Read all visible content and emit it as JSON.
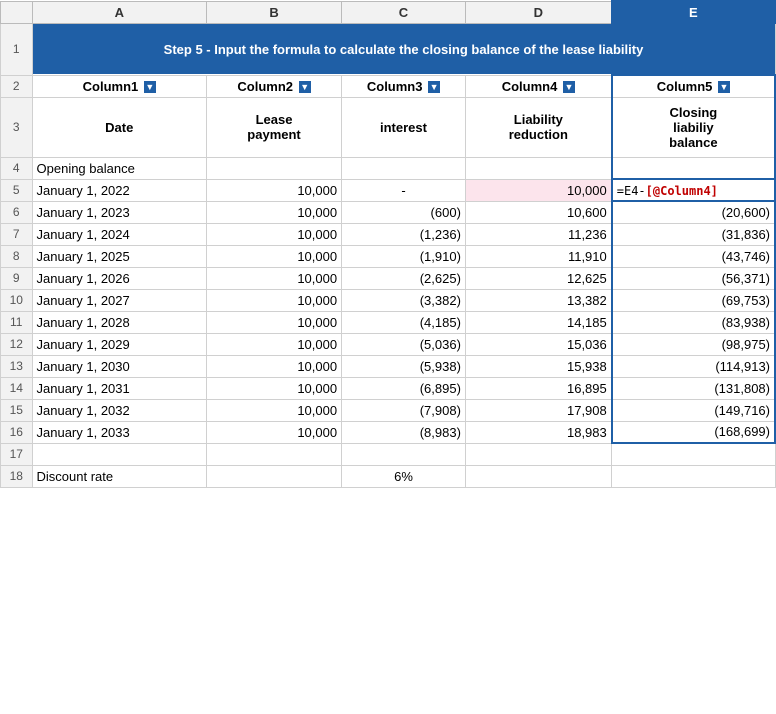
{
  "title": "Step 5 - Input the formula to calculate the closing balance of the lease liability",
  "columns": {
    "headers": [
      "",
      "A",
      "B",
      "C",
      "D",
      "E"
    ],
    "subHeaders": [
      "",
      "Date",
      "Lease payment",
      "interest",
      "Liability reduction",
      "Closing liabiliy balance"
    ]
  },
  "rows": [
    {
      "num": "1",
      "a": "",
      "b": "",
      "c": "",
      "d": "",
      "e": "",
      "merged": true
    },
    {
      "num": "2",
      "a": "Column1",
      "b": "Column2",
      "c": "Column3",
      "d": "Column4",
      "e": "Column5"
    },
    {
      "num": "3",
      "a": "Date",
      "b": "Lease payment",
      "c": "interest",
      "d": "Liability reduction",
      "e": "Closing liabiliy balance"
    },
    {
      "num": "4",
      "a": "Opening balance",
      "b": "",
      "c": "",
      "d": "",
      "e": ""
    },
    {
      "num": "5",
      "a": "January 1, 2022",
      "b": "10,000",
      "c": "-",
      "d": "10,000",
      "e": "=E4-[@Column4]"
    },
    {
      "num": "6",
      "a": "January 1, 2023",
      "b": "10,000",
      "c": "(600)",
      "d": "10,600",
      "e": "(20,600)"
    },
    {
      "num": "7",
      "a": "January 1, 2024",
      "b": "10,000",
      "c": "(1,236)",
      "d": "11,236",
      "e": "(31,836)"
    },
    {
      "num": "8",
      "a": "January 1, 2025",
      "b": "10,000",
      "c": "(1,910)",
      "d": "11,910",
      "e": "(43,746)"
    },
    {
      "num": "9",
      "a": "January 1, 2026",
      "b": "10,000",
      "c": "(2,625)",
      "d": "12,625",
      "e": "(56,371)"
    },
    {
      "num": "10",
      "a": "January 1, 2027",
      "b": "10,000",
      "c": "(3,382)",
      "d": "13,382",
      "e": "(69,753)"
    },
    {
      "num": "11",
      "a": "January 1, 2028",
      "b": "10,000",
      "c": "(4,185)",
      "d": "14,185",
      "e": "(83,938)"
    },
    {
      "num": "12",
      "a": "January 1, 2029",
      "b": "10,000",
      "c": "(5,036)",
      "d": "15,036",
      "e": "(98,975)"
    },
    {
      "num": "13",
      "a": "January 1, 2030",
      "b": "10,000",
      "c": "(5,938)",
      "d": "15,938",
      "e": "(114,913)"
    },
    {
      "num": "14",
      "a": "January 1, 2031",
      "b": "10,000",
      "c": "(6,895)",
      "d": "16,895",
      "e": "(131,808)"
    },
    {
      "num": "15",
      "a": "January 1, 2032",
      "b": "10,000",
      "c": "(7,908)",
      "d": "17,908",
      "e": "(149,716)"
    },
    {
      "num": "16",
      "a": "January 1, 2033",
      "b": "10,000",
      "c": "(8,983)",
      "d": "18,983",
      "e": "(168,699)"
    },
    {
      "num": "17",
      "a": "",
      "b": "",
      "c": "",
      "d": "",
      "e": ""
    },
    {
      "num": "18",
      "a": "Discount rate",
      "b": "",
      "c": "6%",
      "d": "",
      "e": ""
    }
  ],
  "labels": {
    "filter_icon": "▼",
    "formula_e4": "=E4-",
    "formula_col4": "[@Column4]"
  }
}
